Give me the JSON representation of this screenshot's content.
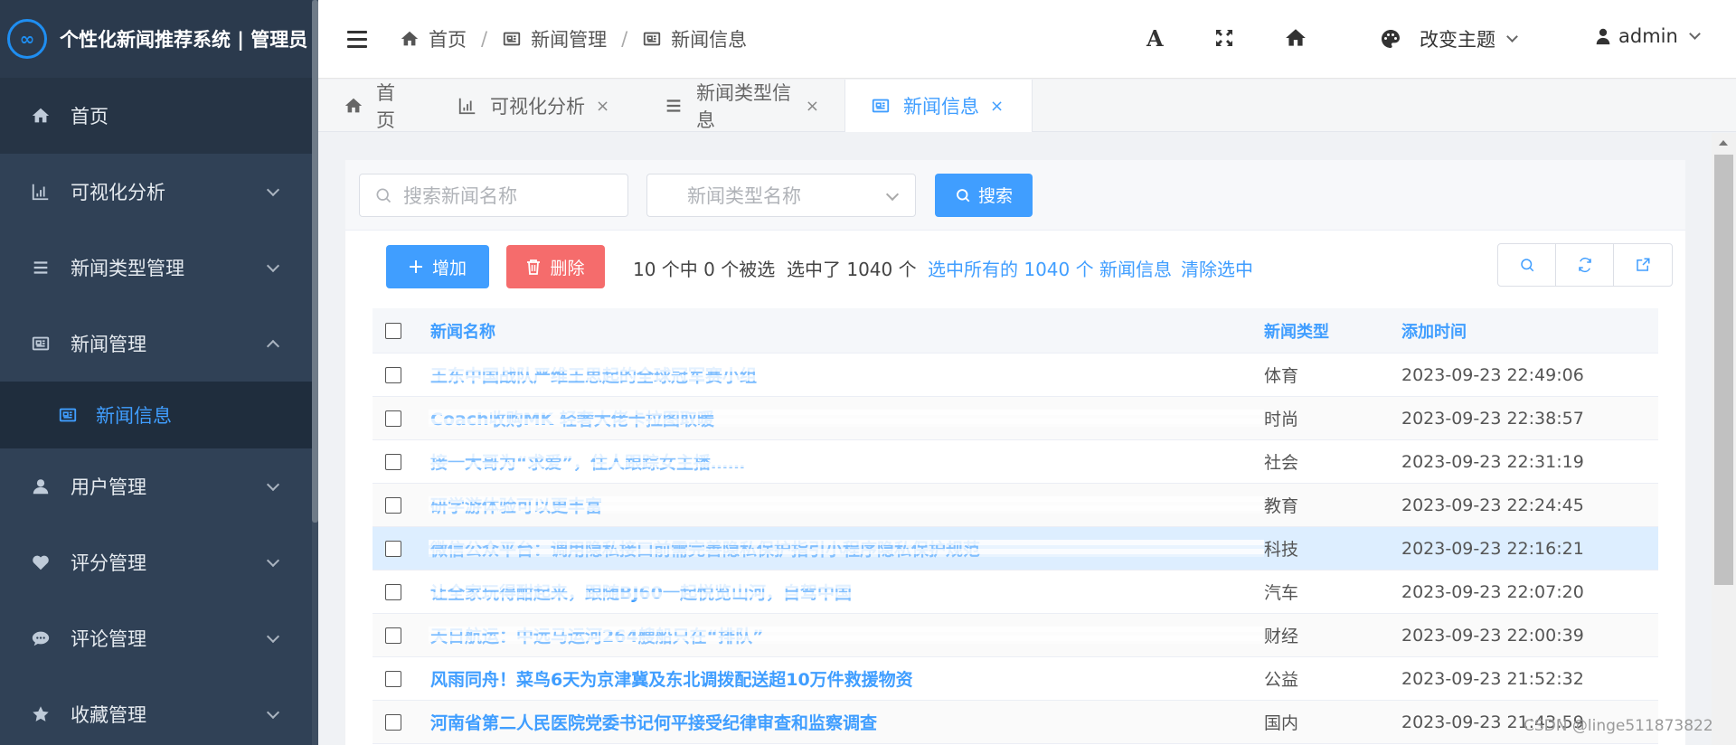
{
  "app": {
    "title": "个性化新闻推荐系统 | 管理员",
    "logo_glyph": "∞"
  },
  "sidebar": {
    "items": [
      {
        "label": "首页",
        "icon": "home-icon"
      },
      {
        "label": "可视化分析",
        "icon": "chart-icon"
      },
      {
        "label": "新闻类型管理",
        "icon": "list-icon"
      },
      {
        "label": "新闻管理",
        "icon": "news-icon"
      },
      {
        "label": "新闻信息",
        "icon": "news-icon"
      },
      {
        "label": "用户管理",
        "icon": "user-icon"
      },
      {
        "label": "评分管理",
        "icon": "heart-icon"
      },
      {
        "label": "评论管理",
        "icon": "comment-icon"
      },
      {
        "label": "收藏管理",
        "icon": "star-icon"
      }
    ]
  },
  "breadcrumb": [
    "首页",
    "新闻管理",
    "新闻信息"
  ],
  "topbar": {
    "font_icon_label": "A",
    "theme_label": "改变主题",
    "user_label": "admin"
  },
  "tabs": [
    {
      "label": "首页",
      "closable": false
    },
    {
      "label": "可视化分析",
      "closable": true
    },
    {
      "label": "新闻类型信息",
      "closable": true
    },
    {
      "label": "新闻信息",
      "closable": true,
      "active": true
    }
  ],
  "tab_close_glyph": "×",
  "search": {
    "name_placeholder": "搜索新闻名称",
    "type_placeholder": "新闻类型名称",
    "button_label": "搜索"
  },
  "toolbar": {
    "add_label": "增加",
    "delete_label": "删除",
    "selection_info": "10 个中 0 个被选",
    "selected_count": "选中了 1040 个",
    "select_all": "选中所有的 1040 个 新闻信息",
    "clear_selection": "清除选中"
  },
  "table": {
    "headers": {
      "name": "新闻名称",
      "type": "新闻类型",
      "time": "添加时间"
    },
    "rows": [
      {
        "name": "王东中国战队严维王思起的全球冠军赛小组",
        "type": "体育",
        "time": "2023-09-23 22:49:06",
        "redacted": true
      },
      {
        "name": "Coach收购MK 轻奢大佬卡拉图取暖",
        "type": "时尚",
        "time": "2023-09-23 22:38:57",
        "redacted": true
      },
      {
        "name": "接一大哥为“求爱”，住人跟踪女主播……",
        "type": "社会",
        "time": "2023-09-23 22:31:19",
        "redacted": true
      },
      {
        "name": "研学游体验可以更丰富",
        "type": "教育",
        "time": "2023-09-23 22:24:45",
        "redacted": true
      },
      {
        "name": "微信公众平台：调用隐私接口前需完善隐私保护指引小程序隐私保护规范",
        "type": "科技",
        "time": "2023-09-23 22:16:21",
        "redacted": true
      },
      {
        "name": "让全家玩得酣起来，跟随BJ60一起悦览山河，自驾中国",
        "type": "汽车",
        "time": "2023-09-23 22:07:20",
        "redacted": true
      },
      {
        "name": "天日航运：中远马运河264艘船只在“排队”",
        "type": "财经",
        "time": "2023-09-23 22:00:39",
        "redacted": true
      },
      {
        "name": "风雨同舟！菜鸟6天为京津冀及东北调拨配送超10万件救援物资",
        "type": "公益",
        "time": "2023-09-23 21:52:32",
        "redacted": false
      },
      {
        "name": "河南省第二人民医院党委书记何平接受纪律审查和监察调查",
        "type": "国内",
        "time": "2023-09-23 21:43:59",
        "redacted": false
      }
    ]
  },
  "watermark": "CSDN @linge511873822",
  "colors": {
    "sidebar_bg": "#304156",
    "accent": "#409eff",
    "danger": "#f56c6c",
    "highlight_row": "#ddeeff"
  }
}
